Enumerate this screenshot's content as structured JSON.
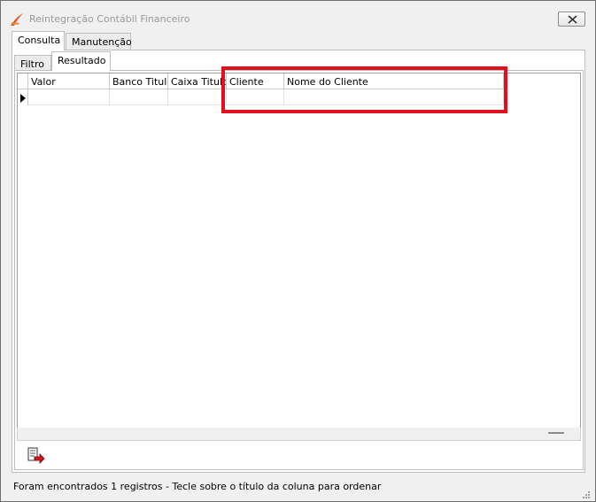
{
  "window": {
    "title": "Reintegração Contábil Financeiro"
  },
  "outer_tabs": [
    {
      "label": "Consulta",
      "active": true
    },
    {
      "label": "Manutenção",
      "active": false
    }
  ],
  "inner_tabs": [
    {
      "label": "Filtro",
      "active": false
    },
    {
      "label": "Resultado",
      "active": true
    }
  ],
  "grid": {
    "columns": [
      "Valor",
      "Banco Titulo",
      "Caixa Titulo",
      "Cliente",
      "Nome do Cliente"
    ],
    "rows": [
      [
        "",
        "",
        "",
        "",
        ""
      ]
    ]
  },
  "status": {
    "text": "Foram encontrados 1 registros  - Tecle sobre o título da coluna para ordenar"
  },
  "icons": {
    "app": "swoosh-logo-icon",
    "close": "close-icon",
    "export": "export-arrow-icon",
    "row_indicator": "current-row-arrow-icon",
    "grip": "resize-grip-icon"
  },
  "colors": {
    "highlight": "#e0101e",
    "logo": "#e8561a"
  }
}
